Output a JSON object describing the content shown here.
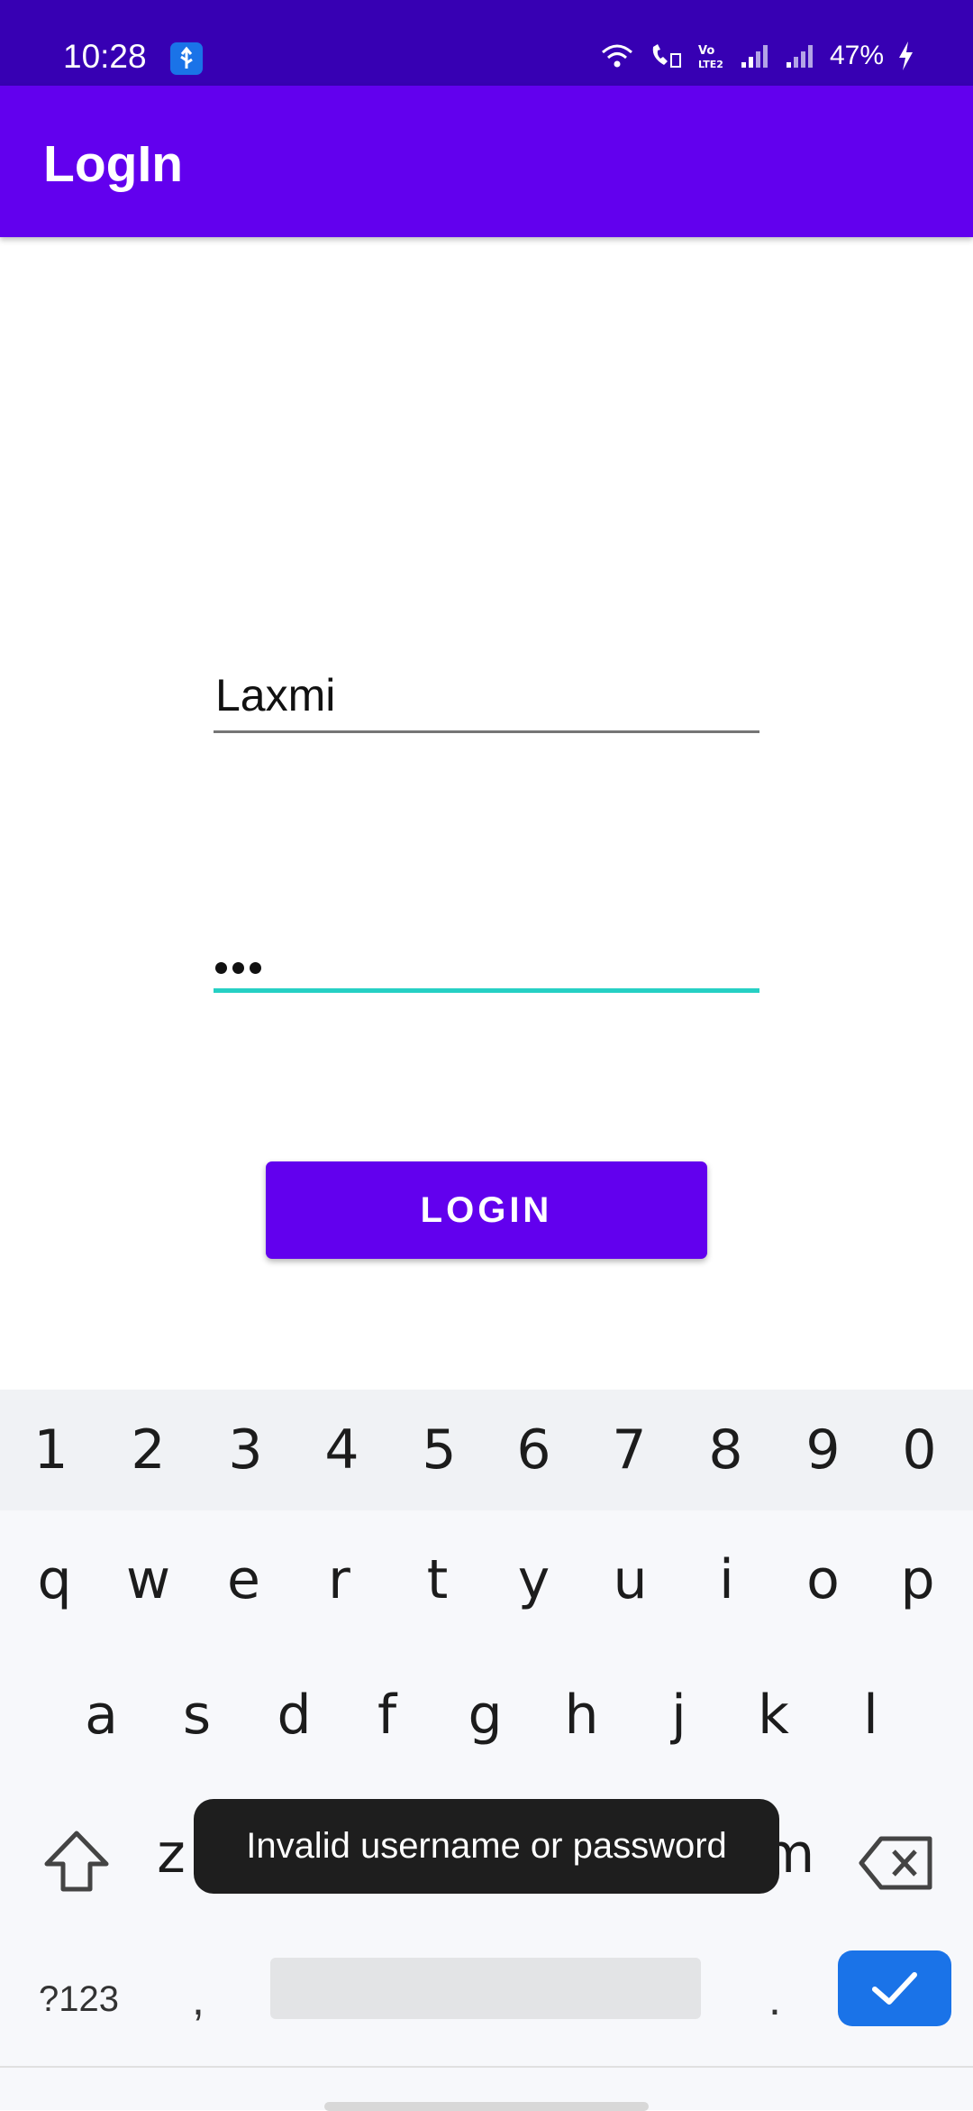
{
  "status_bar": {
    "time": "10:28",
    "battery": "47%",
    "icons": [
      "usb-icon",
      "wifi-icon",
      "wifi-call-icon",
      "volte-icon",
      "signal-icon",
      "signal-icon",
      "charging-icon"
    ]
  },
  "app_bar": {
    "title": "LogIn"
  },
  "form": {
    "username_value": "Laxmi",
    "password_masked_length": 3,
    "login_label": "LOGIN"
  },
  "keyboard": {
    "number_row": [
      "1",
      "2",
      "3",
      "4",
      "5",
      "6",
      "7",
      "8",
      "9",
      "0"
    ],
    "row1": [
      "q",
      "w",
      "e",
      "r",
      "t",
      "y",
      "u",
      "i",
      "o",
      "p"
    ],
    "row2": [
      "a",
      "s",
      "d",
      "f",
      "g",
      "h",
      "j",
      "k",
      "l"
    ],
    "row3_visible": [
      "z",
      "m"
    ],
    "symbols_label": "?123",
    "comma": ",",
    "period": "."
  },
  "toast": {
    "message": "Invalid username or password"
  },
  "colors": {
    "status_bar": "#3700b3",
    "app_bar": "#6200ee",
    "button": "#6200ee",
    "focused_underline": "#26d0c4",
    "enter_key": "#1a73e8"
  }
}
